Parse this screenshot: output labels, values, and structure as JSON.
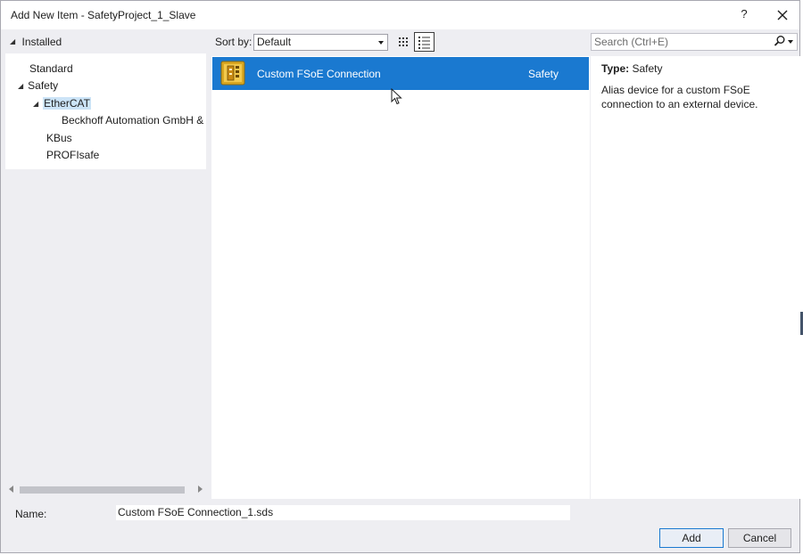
{
  "window": {
    "title": "Add New Item - SafetyProject_1_Slave",
    "help": "?"
  },
  "tree": {
    "root_label": "Installed",
    "items": [
      {
        "label": "Standard"
      },
      {
        "label": "Safety"
      },
      {
        "label": "EtherCAT"
      },
      {
        "label": "Beckhoff Automation GmbH & Co. KG"
      },
      {
        "label": "KBus"
      },
      {
        "label": "PROFIsafe"
      }
    ],
    "selected": "EtherCAT"
  },
  "toolbar": {
    "sort_label": "Sort by:",
    "sort_value": "Default",
    "search_placeholder": "Search (Ctrl+E)"
  },
  "templates": [
    {
      "name": "Custom FSoE Connection",
      "category": "Safety",
      "icon": "fsoe-connection-icon"
    }
  ],
  "details": {
    "type_label": "Type:",
    "type_value": "Safety",
    "description": "Alias device for a custom FSoE connection to an external device."
  },
  "footer": {
    "name_label": "Name:",
    "name_value": "Custom FSoE Connection_1.sds",
    "add_label": "Add",
    "cancel_label": "Cancel"
  },
  "colors": {
    "selection": "#1a79d0",
    "tree_selection": "#cce4f7",
    "dialog_bg": "#eeeef2"
  }
}
